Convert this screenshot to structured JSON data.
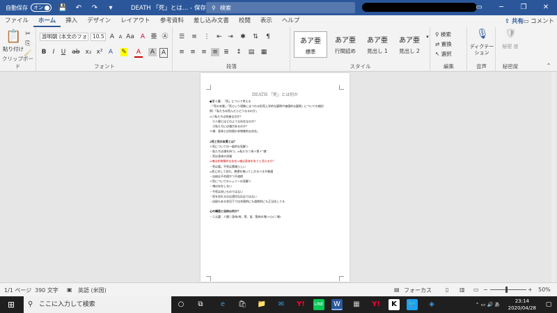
{
  "titlebar": {
    "autosave_label": "自動保存",
    "autosave_state": "オン",
    "doc_title": "DEATH 「死」とは… - 保存済み ▾",
    "search_placeholder": "検索",
    "win_minimize": "─",
    "win_restore": "❐",
    "win_close": "✕",
    "save_icon": "💾",
    "undo_icon": "↶",
    "redo_icon": "↷",
    "customize_icon": "▾",
    "ribbon_display_icon": "▭"
  },
  "tabs": [
    "ファイル",
    "ホーム",
    "挿入",
    "デザイン",
    "レイアウト",
    "参考資料",
    "差し込み文書",
    "校閲",
    "表示",
    "ヘルプ"
  ],
  "share_label": "共有",
  "comment_label": "コメント",
  "ribbon": {
    "clipboard": {
      "paste": "貼り付け",
      "label": "クリップボード"
    },
    "font": {
      "name": "游明朝 (本文のフォ",
      "size": "10.5",
      "label": "フォント"
    },
    "paragraph": {
      "label": "段落"
    },
    "styles": {
      "items": [
        {
          "sample": "あア亜",
          "name": "標準"
        },
        {
          "sample": "あア亜",
          "name": "行間詰め"
        },
        {
          "sample": "あア亜",
          "name": "見出し 1"
        },
        {
          "sample": "あア亜",
          "name": "見出し 2"
        }
      ],
      "label": "スタイル"
    },
    "editing": {
      "find": "検索",
      "replace": "置換",
      "select": "選択",
      "label": "編集"
    },
    "voice": {
      "dictate": "ディクテー ション",
      "label": "音声"
    },
    "sensitivity": {
      "name": "秘密 度",
      "label": "秘密度"
    }
  },
  "document": {
    "header": "DEATH 「死」とは何か",
    "lines": [
      {
        "t": "●第１講：「死」について考える",
        "s": ""
      },
      {
        "t": "・「死の本質」「死という現象にまつわる形而上学的な疑問や価値的な疑問」についての検討",
        "s": ""
      },
      {
        "t": "例）「私たちは死んだらどうなるのか」",
        "s": ""
      },
      {
        "t": "⇒①私たちは何者なのか？",
        "s": ""
      },
      {
        "t": "　②人間とはどのような存在なのか？",
        "s": ""
      },
      {
        "t": "　③私たちには魂があるのか？",
        "s": ""
      },
      {
        "t": "※魂：身体とは別個の非物質的な存在。",
        "s": ""
      },
      {
        "t": "",
        "s": ""
      },
      {
        "t": "2死と死の本質とは？",
        "s": "b"
      },
      {
        "t": "＜死についての一般的な見解＞",
        "s": ""
      },
      {
        "t": "・私たちは魂を持つ。⇒私たち＝肉＋骨＋“魂”",
        "s": ""
      },
      {
        "t": "・死は身体の消滅",
        "s": ""
      },
      {
        "t": "⇒魂は非物質的な存在⇒魂は身体を失うと消えるか？",
        "s": "red"
      },
      {
        "t": "・死は悪。不死は素晴らしい",
        "s": ""
      },
      {
        "t": "⇒死に対して恐れ、絶望を抱いてしかるべきが普通",
        "s": ""
      },
      {
        "t": "・自殺は不合理かつ不道徳",
        "s": ""
      },
      {
        "t": "＜死についてのシェリーの見解＞",
        "s": ""
      },
      {
        "t": "・魂は存在しない",
        "s": ""
      },
      {
        "t": "・不死は良いものではない",
        "s": ""
      },
      {
        "t": "・死を恐れるのは適切な反応ではない",
        "s": ""
      },
      {
        "t": "・自殺もある状況下では合理的にも道徳的にも正当化しうる",
        "s": ""
      },
      {
        "t": "",
        "s": ""
      },
      {
        "t": "心の構造と自体は何か？",
        "s": "b"
      },
      {
        "t": "・二元論：人間＝身体(肉、骨、血、筋肉の塊)＋心(＝魂)",
        "s": ""
      }
    ]
  },
  "status": {
    "page": "1/1 ページ",
    "words": "390 文字",
    "lang": "英語 (米国)",
    "focus": "フォーカス",
    "zoom": "50%"
  },
  "taskbar": {
    "search_placeholder": "ここに入力して検索",
    "time": "23:14",
    "date": "2020/04/28"
  }
}
